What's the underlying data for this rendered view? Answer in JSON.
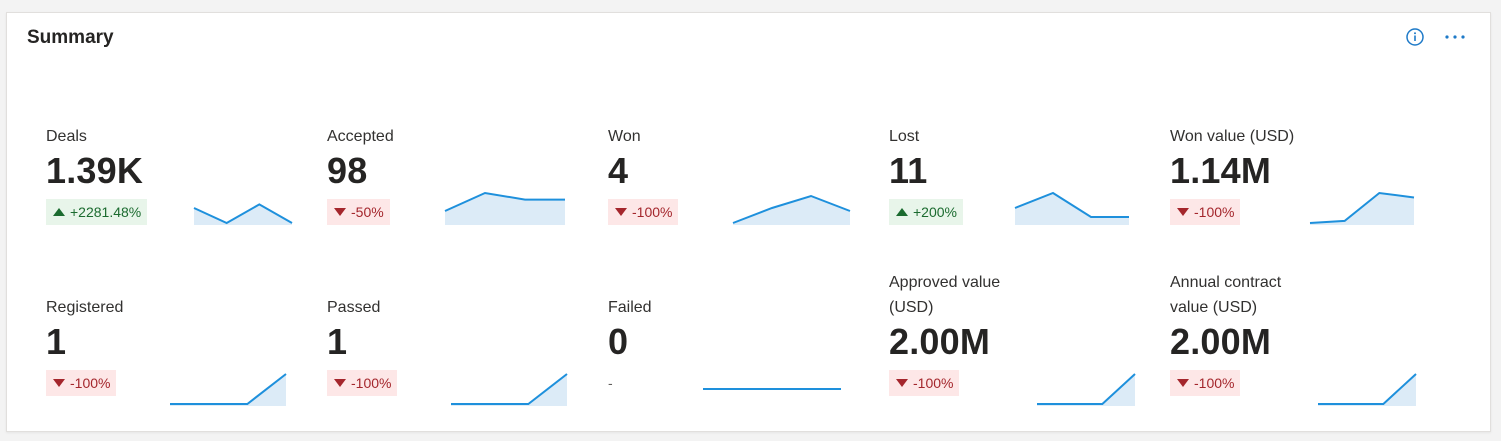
{
  "card": {
    "title": "Summary"
  },
  "colors": {
    "spark_line": "#1e90dc",
    "spark_fill": "#dcebf7",
    "up": "#1b6b2f",
    "down": "#a4262c"
  },
  "kpis": [
    {
      "label": "Deals",
      "value": "1.39K",
      "change": "+2281.48%",
      "direction": "up",
      "spark": [
        0.5,
        0.0,
        0.62,
        0.0
      ]
    },
    {
      "label": "Accepted",
      "value": "98",
      "change": "-50%",
      "direction": "down",
      "spark": [
        0.4,
        1.0,
        0.78,
        0.78
      ]
    },
    {
      "label": "Won",
      "value": "4",
      "change": "-100%",
      "direction": "down",
      "spark": [
        0.0,
        0.5,
        0.9,
        0.4
      ]
    },
    {
      "label": "Lost",
      "value": "11",
      "change": "+200%",
      "direction": "up",
      "spark": [
        0.5,
        1.0,
        0.2,
        0.2
      ]
    },
    {
      "label": "Won value (USD)",
      "value": "1.14M",
      "change": "-100%",
      "direction": "down",
      "spark": [
        0.0,
        0.07,
        1.0,
        0.85
      ]
    },
    {
      "label": "Registered",
      "value": "1",
      "change": "-100%",
      "direction": "down",
      "spark": [
        0.0,
        0.0,
        0.0,
        1.0
      ]
    },
    {
      "label": "Passed",
      "value": "1",
      "change": "-100%",
      "direction": "down",
      "spark": [
        0.0,
        0.0,
        0.0,
        1.0
      ]
    },
    {
      "label": "Failed",
      "value": "0",
      "change": "-",
      "direction": "none",
      "spark": [
        0.5,
        0.5,
        0.5,
        0.5
      ]
    },
    {
      "label": "Approved value (USD)",
      "value": "2.00M",
      "change": "-100%",
      "direction": "down",
      "spark": [
        0.0,
        0.0,
        0.0,
        1.0
      ]
    },
    {
      "label": "Annual contract value (USD)",
      "value": "2.00M",
      "change": "-100%",
      "direction": "down",
      "spark": [
        0.0,
        0.0,
        0.0,
        1.0
      ]
    }
  ]
}
